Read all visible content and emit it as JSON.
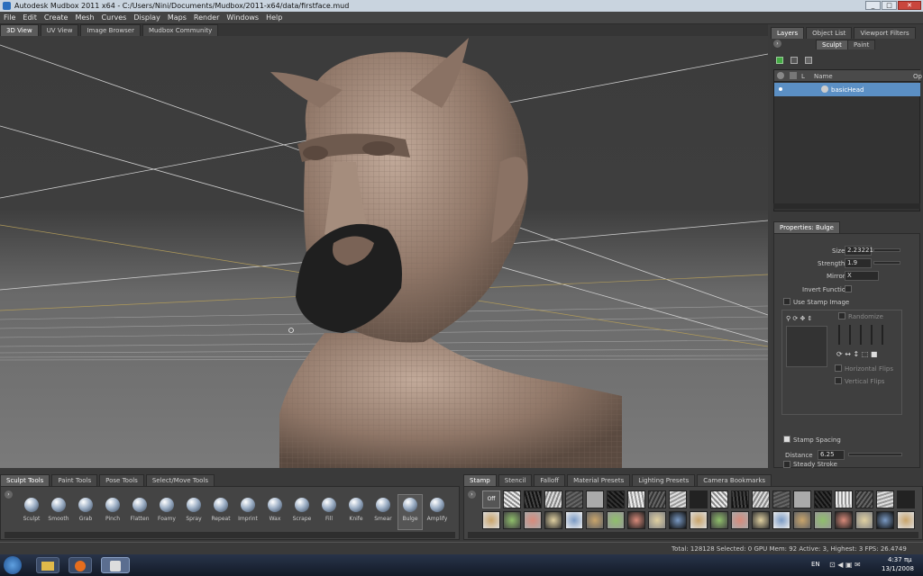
{
  "window": {
    "title": "Autodesk Mudbox 2011 x64 - C:/Users/Nini/Documents/Mudbox/2011-x64/data/firstface.mud",
    "min_label": "_",
    "max_label": "□",
    "close_label": "✕"
  },
  "menu": [
    "File",
    "Edit",
    "Create",
    "Mesh",
    "Curves",
    "Display",
    "Maps",
    "Render",
    "Windows",
    "Help"
  ],
  "view_tabs": [
    "3D View",
    "UV View",
    "Image Browser",
    "Mudbox Community"
  ],
  "right_panel": {
    "tabs": [
      "Layers",
      "Object List",
      "Viewport Filters"
    ],
    "subtabs": [
      "Sculpt",
      "Paint"
    ],
    "layer_headers": {
      "lock": "L",
      "name": "Name",
      "opacity": "Op"
    },
    "layers": [
      {
        "name": "basicHead"
      }
    ],
    "properties_title": "Properties: Bulge",
    "size_label": "Size",
    "size_value": "2.23221",
    "strength_label": "Strength",
    "strength_value": "1.9",
    "mirror_label": "Mirror",
    "mirror_value": "X",
    "invert_label": "Invert Function",
    "use_stamp_label": "Use Stamp Image",
    "randomize_label": "Randomize",
    "horizontal_flips_label": "Horizontal Flips",
    "vertical_flips_label": "Vertical Flips",
    "stamp_spacing_label": "Stamp Spacing",
    "distance_label": "Distance",
    "distance_value": "6.25",
    "steady_stroke_label": "Steady Stroke"
  },
  "tool_tabs": [
    "Sculpt Tools",
    "Paint Tools",
    "Pose Tools",
    "Select/Move Tools"
  ],
  "tools": [
    "Sculpt",
    "Smooth",
    "Grab",
    "Pinch",
    "Flatten",
    "Foamy",
    "Spray",
    "Repeat",
    "Imprint",
    "Wax",
    "Scrape",
    "Fill",
    "Knife",
    "Smear",
    "Bulge",
    "Amplify"
  ],
  "selected_tool": "Bulge",
  "stamp_tabs": [
    "Stamp",
    "Stencil",
    "Falloff",
    "Material Presets",
    "Lighting Presets",
    "Camera Bookmarks"
  ],
  "stamp_off_label": "Off",
  "status": "Total: 128128  Selected: 0 GPU Mem: 92  Active: 3, Highest: 3  FPS: 26.4749",
  "taskbar": {
    "lang": "EN",
    "time": "4:37 πμ",
    "date": "13/1/2008"
  },
  "colors": {
    "layer_selected": "#5b8fc4",
    "skin": "#9c8475",
    "beard": "#1f1f1f"
  }
}
